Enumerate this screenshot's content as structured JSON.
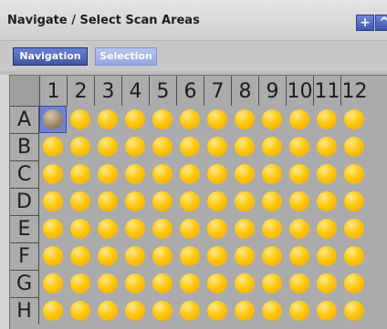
{
  "window": {
    "title": "Navigate / Select Scan Areas",
    "add_glyph": "+",
    "collapse_glyph": "^"
  },
  "tabs": [
    {
      "label": "Navigation",
      "active": true
    },
    {
      "label": "Selection",
      "active": false
    }
  ],
  "plate": {
    "columns": [
      "1",
      "2",
      "3",
      "4",
      "5",
      "6",
      "7",
      "8",
      "9",
      "10",
      "11",
      "12"
    ],
    "rows": [
      "A",
      "B",
      "C",
      "D",
      "E",
      "F",
      "G",
      "H"
    ],
    "selected_well": "A1",
    "colors": {
      "well_fill": "#ffc80e",
      "selected_highlight": "#7182d2",
      "plate_background": "#ababab"
    }
  },
  "icons": [
    "add-icon",
    "collapse-icon"
  ]
}
